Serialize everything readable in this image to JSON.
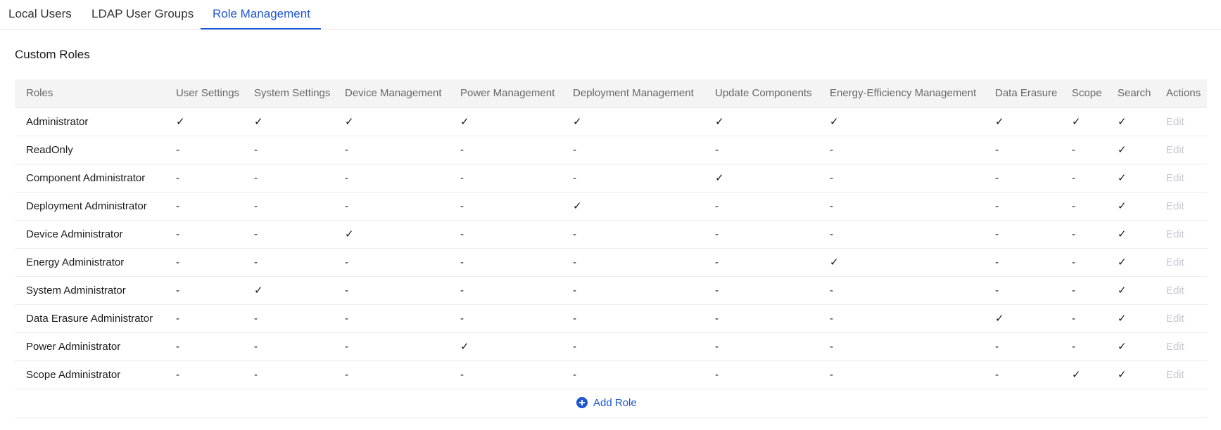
{
  "tabs": [
    {
      "label": "Local Users",
      "active": false
    },
    {
      "label": "LDAP User Groups",
      "active": false
    },
    {
      "label": "Role Management",
      "active": true
    }
  ],
  "section_title": "Custom Roles",
  "columns": [
    "Roles",
    "User Settings",
    "System Settings",
    "Device Management",
    "Power Management",
    "Deployment Management",
    "Update Components",
    "Energy-Efficiency Management",
    "Data Erasure",
    "Scope",
    "Search",
    "Actions"
  ],
  "rows": [
    {
      "role": "Administrator",
      "cells": [
        "✓",
        "✓",
        "✓",
        "✓",
        "✓",
        "✓",
        "✓",
        "✓",
        "✓",
        "✓"
      ],
      "action": "Edit"
    },
    {
      "role": "ReadOnly",
      "cells": [
        "-",
        "-",
        "-",
        "-",
        "-",
        "-",
        "-",
        "-",
        "-",
        "✓"
      ],
      "action": "Edit"
    },
    {
      "role": "Component Administrator",
      "cells": [
        "-",
        "-",
        "-",
        "-",
        "-",
        "✓",
        "-",
        "-",
        "-",
        "✓"
      ],
      "action": "Edit"
    },
    {
      "role": "Deployment Administrator",
      "cells": [
        "-",
        "-",
        "-",
        "-",
        "✓",
        "-",
        "-",
        "-",
        "-",
        "✓"
      ],
      "action": "Edit"
    },
    {
      "role": "Device Administrator",
      "cells": [
        "-",
        "-",
        "✓",
        "-",
        "-",
        "-",
        "-",
        "-",
        "-",
        "✓"
      ],
      "action": "Edit"
    },
    {
      "role": "Energy Administrator",
      "cells": [
        "-",
        "-",
        "-",
        "-",
        "-",
        "-",
        "✓",
        "-",
        "-",
        "✓"
      ],
      "action": "Edit"
    },
    {
      "role": "System Administrator",
      "cells": [
        "-",
        "✓",
        "-",
        "-",
        "-",
        "-",
        "-",
        "-",
        "-",
        "✓"
      ],
      "action": "Edit"
    },
    {
      "role": "Data Erasure Administrator",
      "cells": [
        "-",
        "-",
        "-",
        "-",
        "-",
        "-",
        "-",
        "✓",
        "-",
        "✓"
      ],
      "action": "Edit"
    },
    {
      "role": "Power Administrator",
      "cells": [
        "-",
        "-",
        "-",
        "✓",
        "-",
        "-",
        "-",
        "-",
        "-",
        "✓"
      ],
      "action": "Edit"
    },
    {
      "role": "Scope Administrator",
      "cells": [
        "-",
        "-",
        "-",
        "-",
        "-",
        "-",
        "-",
        "-",
        "✓",
        "✓"
      ],
      "action": "Edit"
    }
  ],
  "add_role_label": "Add Role",
  "colors": {
    "accent": "#1f57d1",
    "header_bg": "#f4f4f5",
    "disabled_text": "#c4c8cf"
  }
}
